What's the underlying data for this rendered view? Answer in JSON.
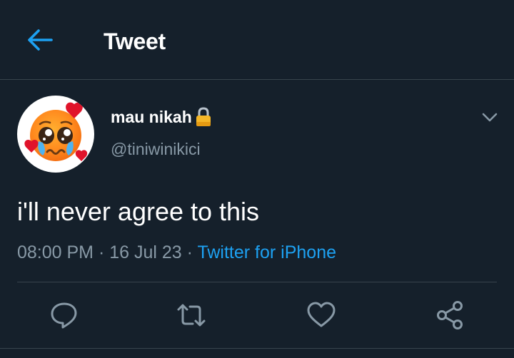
{
  "header": {
    "title": "Tweet",
    "back_icon": "arrow-left-icon"
  },
  "author": {
    "name": "mau nikah",
    "handle": "@tiniwinikici",
    "protected": true,
    "lock_icon": "lock-icon",
    "avatar_icon": "pleading-face-hearts-emoji"
  },
  "tweet": {
    "text": "i'll never agree to this",
    "time": "08:00 PM",
    "separator": " · ",
    "date": "16 Jul 23",
    "source": "Twitter for iPhone"
  },
  "actions": {
    "reply_icon": "reply-icon",
    "retweet_icon": "retweet-icon",
    "like_icon": "heart-icon",
    "share_icon": "share-icon"
  },
  "colors": {
    "background": "#15202b",
    "divider": "#38444d",
    "accent": "#1da1f2",
    "secondary_text": "#8899a6",
    "primary_text": "#ffffff",
    "lock": "#f5b728"
  }
}
